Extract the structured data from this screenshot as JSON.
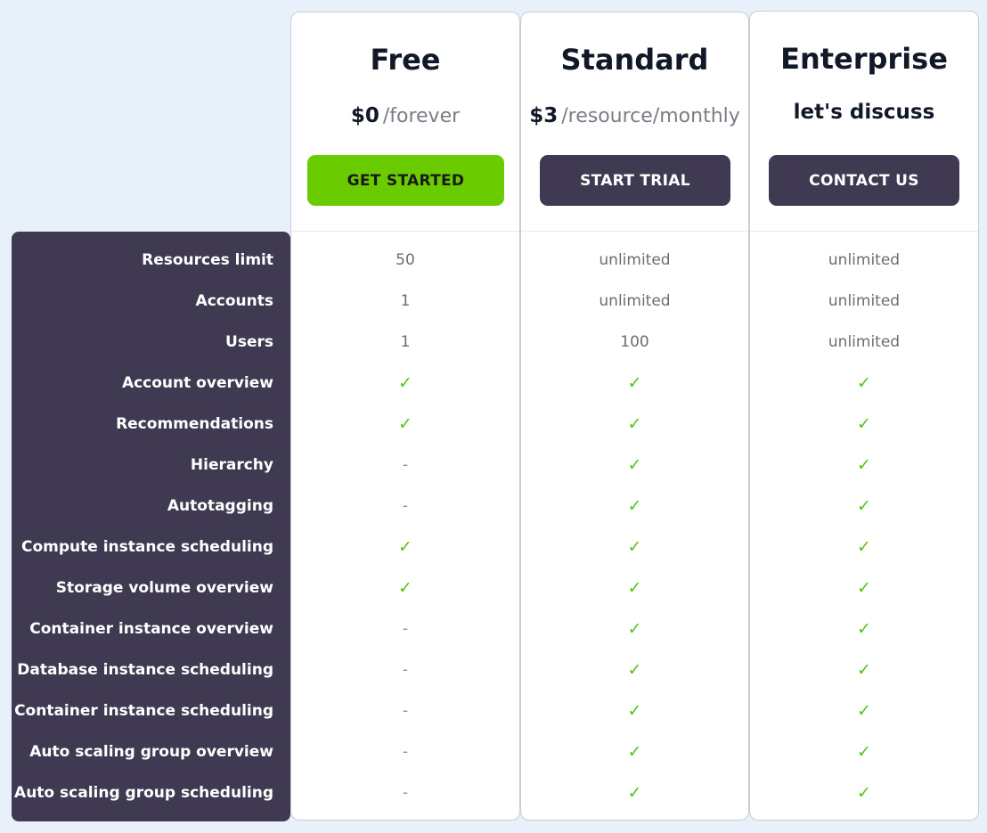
{
  "colors": {
    "background": "#e8f1fa",
    "feature_panel": "#3f3a52",
    "accent_green": "#6acc00",
    "check_green": "#56c21a",
    "dark_button": "#3f3a52"
  },
  "features": [
    "Resources limit",
    "Accounts",
    "Users",
    "Account overview",
    "Recommendations",
    "Hierarchy",
    "Autotagging",
    "Compute instance scheduling",
    "Storage volume overview",
    "Container instance overview",
    "Database instance scheduling",
    "Container instance scheduling",
    "Auto scaling group overview",
    "Auto scaling group scheduling"
  ],
  "plans": [
    {
      "name": "Free",
      "price_amount": "$0",
      "price_period": "/forever",
      "price_text": "",
      "cta_label": "GET STARTED",
      "cta_style": "green",
      "values": [
        "50",
        "1",
        "1",
        "✓",
        "✓",
        "-",
        "-",
        "✓",
        "✓",
        "-",
        "-",
        "-",
        "-",
        "-"
      ]
    },
    {
      "name": "Standard",
      "price_amount": "$3",
      "price_period": "/resource/monthly",
      "price_text": "",
      "cta_label": "START TRIAL",
      "cta_style": "dark",
      "values": [
        "unlimited",
        "unlimited",
        "100",
        "✓",
        "✓",
        "✓",
        "✓",
        "✓",
        "✓",
        "✓",
        "✓",
        "✓",
        "✓",
        "✓"
      ]
    },
    {
      "name": "Enterprise",
      "price_amount": "",
      "price_period": "",
      "price_text": "let's discuss",
      "cta_label": "CONTACT US",
      "cta_style": "dark",
      "values": [
        "unlimited",
        "unlimited",
        "unlimited",
        "✓",
        "✓",
        "✓",
        "✓",
        "✓",
        "✓",
        "✓",
        "✓",
        "✓",
        "✓",
        "✓"
      ]
    }
  ],
  "icons": {
    "check": "check-icon",
    "dash": "dash-icon"
  }
}
